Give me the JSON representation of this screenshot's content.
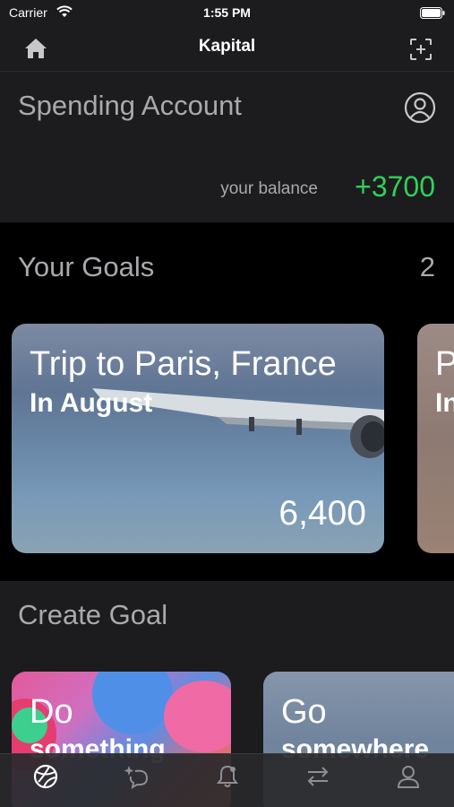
{
  "status_bar": {
    "carrier": "Carrier",
    "time": "1:55 PM"
  },
  "nav": {
    "title": "Kapital",
    "left_icon": "home-icon",
    "right_icon": "scan-icon"
  },
  "spending": {
    "title": "Spending Account",
    "balance_label": "your balance",
    "balance_value": "+3700",
    "balance_color": "#30d158",
    "icon": "profile-icon"
  },
  "goals": {
    "title": "Your Goals",
    "count": "2",
    "cards": [
      {
        "title": "Trip to Paris, France",
        "subtitle": "In August",
        "amount": "6,400"
      },
      {
        "title": "P",
        "subtitle": "In"
      }
    ]
  },
  "create_goal": {
    "title": "Create Goal",
    "cards": [
      {
        "title": "Do",
        "subtitle": "something"
      },
      {
        "title": "Go",
        "subtitle": "somewhere"
      }
    ]
  },
  "tab_bar": {
    "items": [
      "globe-icon",
      "sparkle-chat-icon",
      "bell-icon",
      "transfer-arrows-icon",
      "person-icon"
    ]
  }
}
